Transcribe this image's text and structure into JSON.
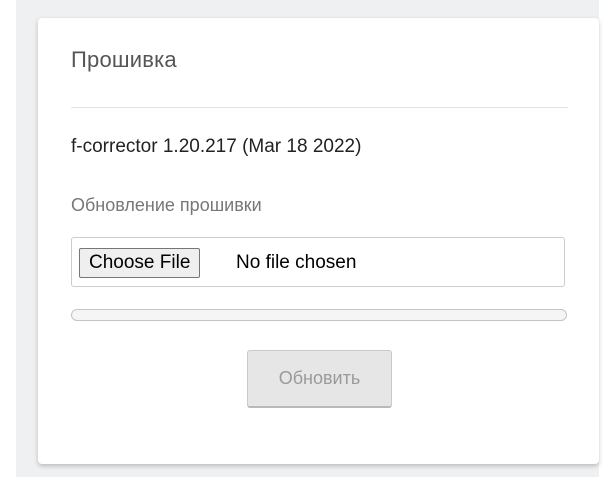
{
  "firmware": {
    "title": "Прошивка",
    "version_text": "f-corrector 1.20.217 (Mar 18 2022)",
    "update_section_label": "Обновление прошивки",
    "file_input": {
      "button_label": "Choose File",
      "status_text": "No file chosen"
    },
    "progress": {
      "percent": 0
    },
    "update_button_label": "Обновить"
  }
}
